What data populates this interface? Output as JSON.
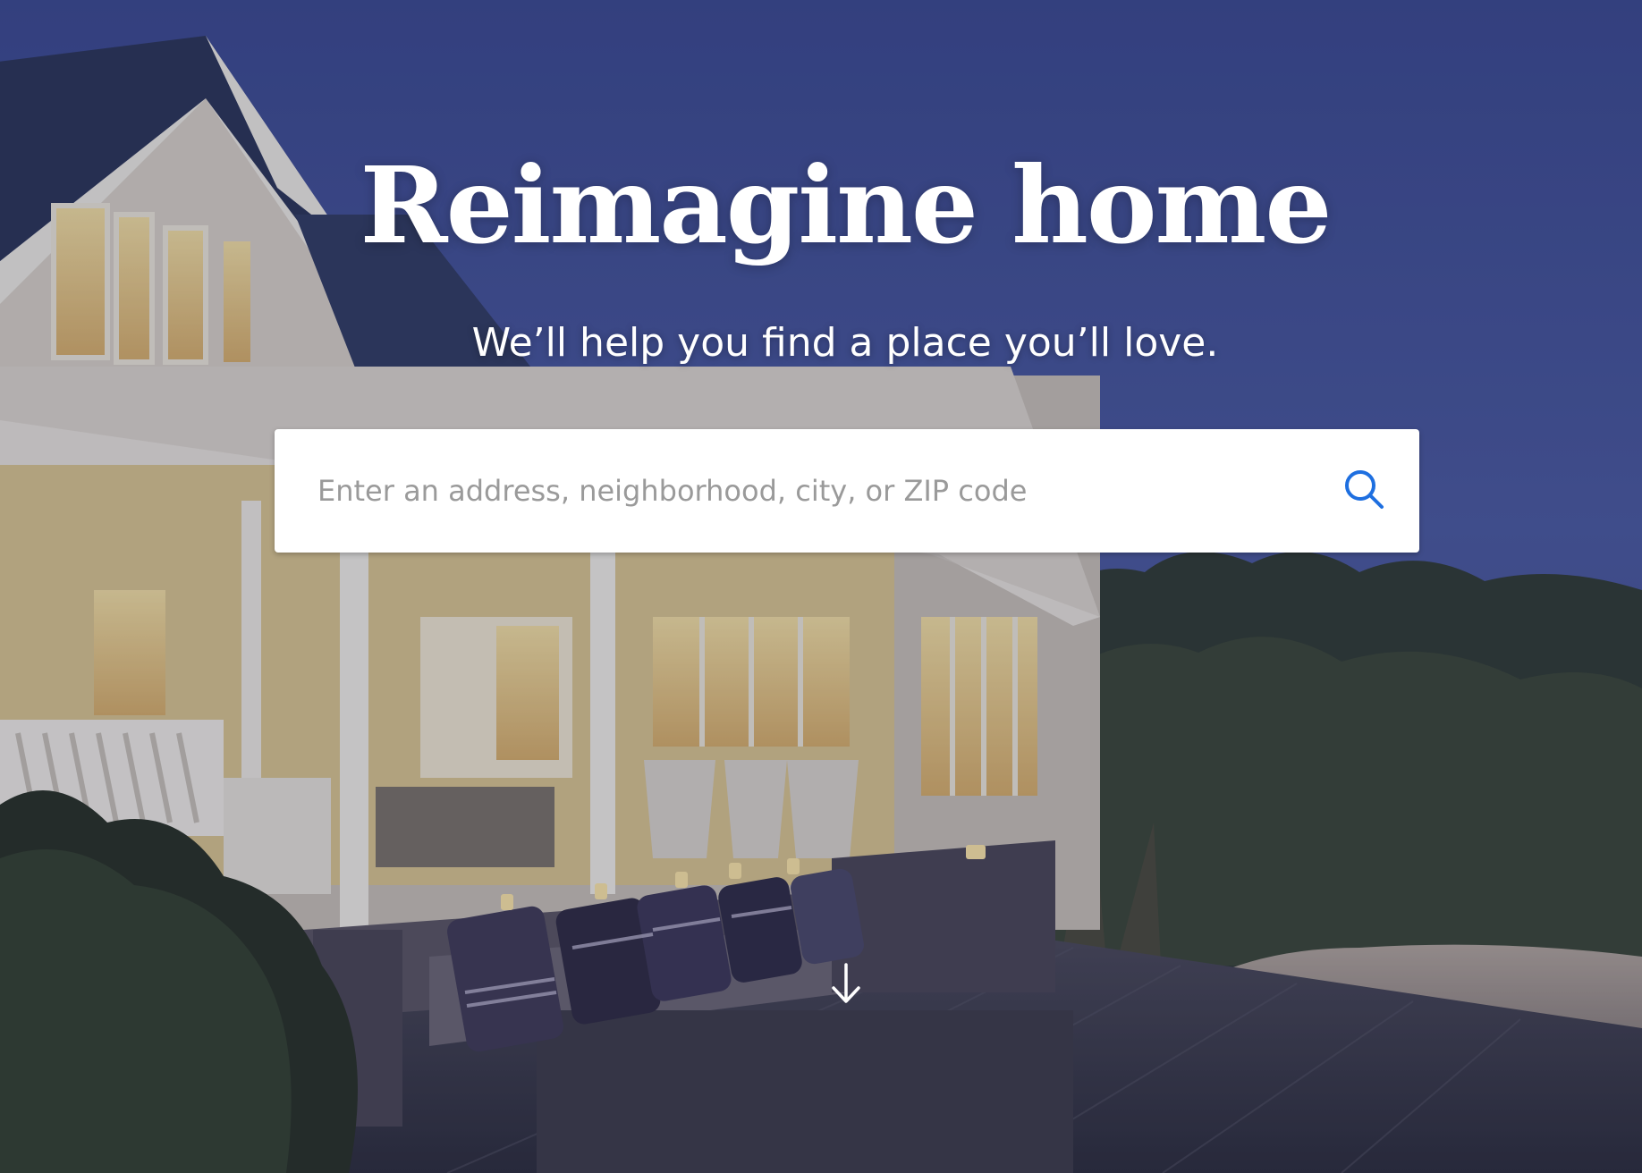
{
  "hero": {
    "title": "Reimagine home",
    "subtitle": "We’ll help you find a place you’ll love."
  },
  "search": {
    "placeholder": "Enter an address, neighborhood, city, or ZIP code",
    "value": ""
  },
  "icons": {
    "search": "search-icon",
    "scroll": "arrow-down-icon"
  },
  "colors": {
    "accent": "#1e6fe0",
    "sky": "#45549a",
    "text": "#ffffff",
    "placeholder": "#9a9a9a"
  }
}
